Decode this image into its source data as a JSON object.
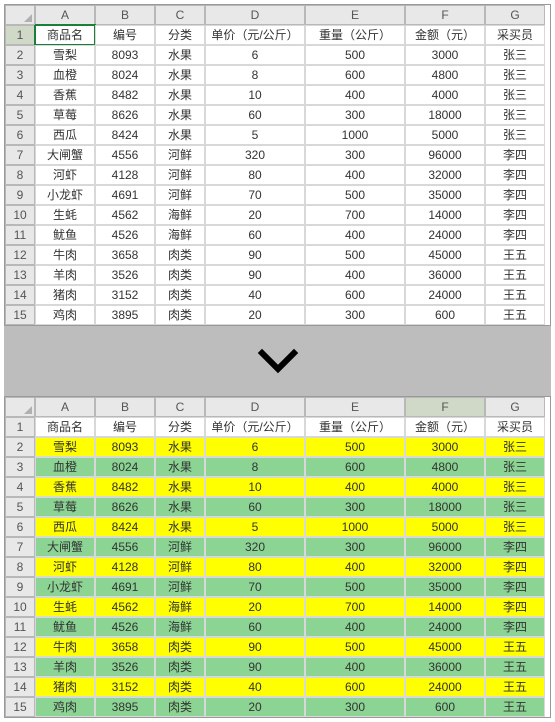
{
  "columns": [
    "A",
    "B",
    "C",
    "D",
    "E",
    "F",
    "G"
  ],
  "headers": {
    "product": "商品名",
    "id": "编号",
    "category": "分类",
    "price": "单价（元/公斤）",
    "weight": "重量（公斤）",
    "amount": "金额（元）",
    "buyer": "采买员"
  },
  "rows": [
    {
      "product": "雪梨",
      "id": 8093,
      "category": "水果",
      "price": 6,
      "weight": 500,
      "amount": 3000,
      "buyer": "张三"
    },
    {
      "product": "血橙",
      "id": 8024,
      "category": "水果",
      "price": 8,
      "weight": 600,
      "amount": 4800,
      "buyer": "张三"
    },
    {
      "product": "香蕉",
      "id": 8482,
      "category": "水果",
      "price": 10,
      "weight": 400,
      "amount": 4000,
      "buyer": "张三"
    },
    {
      "product": "草莓",
      "id": 8626,
      "category": "水果",
      "price": 60,
      "weight": 300,
      "amount": 18000,
      "buyer": "张三"
    },
    {
      "product": "西瓜",
      "id": 8424,
      "category": "水果",
      "price": 5,
      "weight": 1000,
      "amount": 5000,
      "buyer": "张三"
    },
    {
      "product": "大闸蟹",
      "id": 4556,
      "category": "河鲜",
      "price": 320,
      "weight": 300,
      "amount": 96000,
      "buyer": "李四"
    },
    {
      "product": "河虾",
      "id": 4128,
      "category": "河鲜",
      "price": 80,
      "weight": 400,
      "amount": 32000,
      "buyer": "李四"
    },
    {
      "product": "小龙虾",
      "id": 4691,
      "category": "河鲜",
      "price": 70,
      "weight": 500,
      "amount": 35000,
      "buyer": "李四"
    },
    {
      "product": "生蚝",
      "id": 4562,
      "category": "海鲜",
      "price": 20,
      "weight": 700,
      "amount": 14000,
      "buyer": "李四"
    },
    {
      "product": "鱿鱼",
      "id": 4526,
      "category": "海鲜",
      "price": 60,
      "weight": 400,
      "amount": 24000,
      "buyer": "李四"
    },
    {
      "product": "牛肉",
      "id": 3658,
      "category": "肉类",
      "price": 90,
      "weight": 500,
      "amount": 45000,
      "buyer": "王五"
    },
    {
      "product": "羊肉",
      "id": 3526,
      "category": "肉类",
      "price": 90,
      "weight": 400,
      "amount": 36000,
      "buyer": "王五"
    },
    {
      "product": "猪肉",
      "id": 3152,
      "category": "肉类",
      "price": 40,
      "weight": 600,
      "amount": 24000,
      "buyer": "王五"
    },
    {
      "product": "鸡肉",
      "id": 3895,
      "category": "肉类",
      "price": 20,
      "weight": 300,
      "amount": 600,
      "buyer": "王五"
    }
  ],
  "top_active_cell": "A1",
  "bottom_active_col": "F",
  "colors": {
    "yellow": "#ffff00",
    "green": "#8bd494"
  }
}
